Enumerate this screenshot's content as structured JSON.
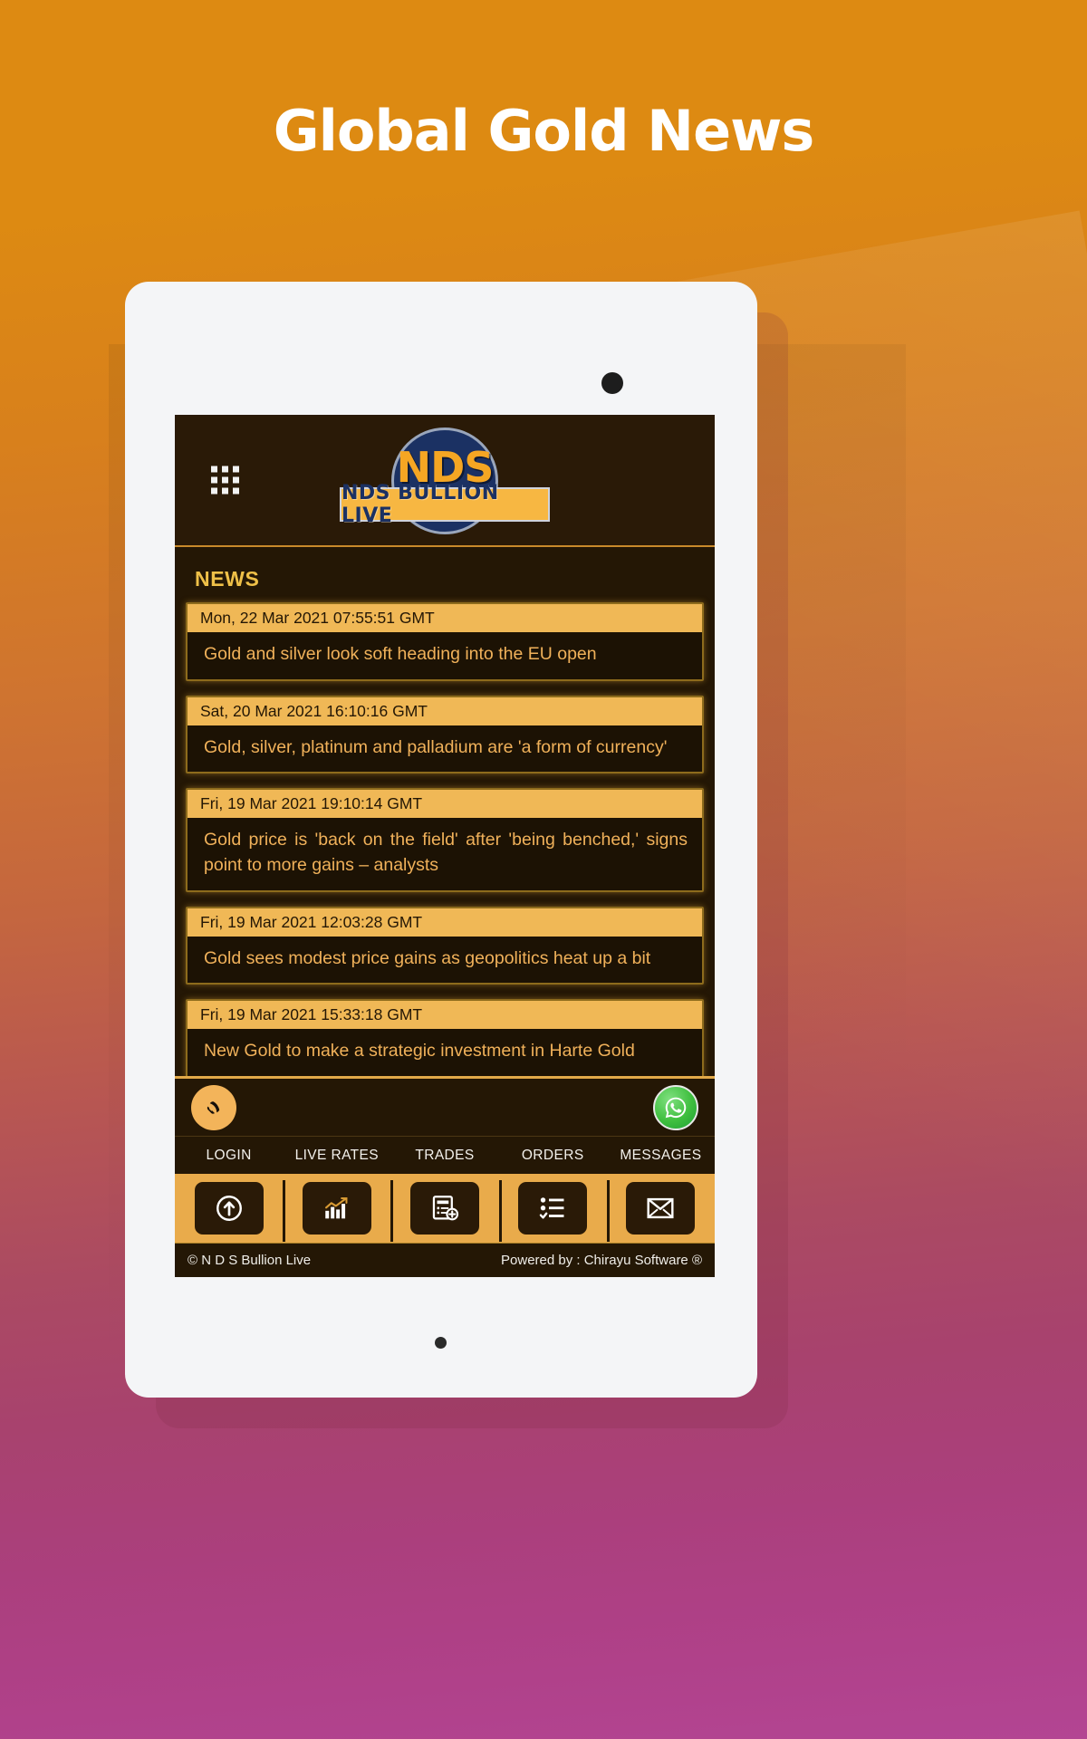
{
  "promo": {
    "title": "Global Gold News"
  },
  "app": {
    "menu_icon": "grid-menu-icon",
    "logo": {
      "mark_text": "NDS",
      "band_text": "NDS BULLION LIVE"
    },
    "news_section_title": "NEWS",
    "news_items": [
      {
        "date": "Mon, 22 Mar 2021 07:55:51 GMT",
        "headline": "Gold and silver look soft heading into the EU open"
      },
      {
        "date": "Sat, 20 Mar 2021 16:10:16 GMT",
        "headline": "Gold, silver, platinum and palladium are 'a form of currency'"
      },
      {
        "date": "Fri, 19 Mar 2021 19:10:14 GMT",
        "headline": "Gold price is 'back on the field' after 'being benched,' signs point to more gains – analysts"
      },
      {
        "date": "Fri, 19 Mar 2021 12:03:28 GMT",
        "headline": "Gold sees modest price gains as geopolitics heat up a bit"
      },
      {
        "date": "Fri, 19 Mar 2021 15:33:18 GMT",
        "headline": "New Gold to make a strategic investment in Harte Gold"
      }
    ],
    "contact": {
      "call_icon": "phone-call-icon",
      "whatsapp_icon": "whatsapp-icon"
    },
    "bottom_nav": [
      {
        "label": "LOGIN",
        "icon": "login-arrow-icon"
      },
      {
        "label": "LIVE RATES",
        "icon": "bar-chart-icon"
      },
      {
        "label": "TRADES",
        "icon": "document-add-icon"
      },
      {
        "label": "ORDERS",
        "icon": "checklist-icon"
      },
      {
        "label": "MESSAGES",
        "icon": "envelope-icon"
      }
    ],
    "footer": {
      "copyright": "© N D S Bullion Live",
      "powered_by": "Powered by : Chirayu Software ®"
    }
  },
  "colors": {
    "promo_gradient_start": "#dd8a12",
    "promo_gradient_end": "#b34593",
    "app_bg": "#241705",
    "gold_accent": "#e9ab4b",
    "headline_text": "#f0b15a",
    "date_band": "#f0b856",
    "logo_blue": "#1b3163",
    "logo_gold": "#f5a623"
  }
}
